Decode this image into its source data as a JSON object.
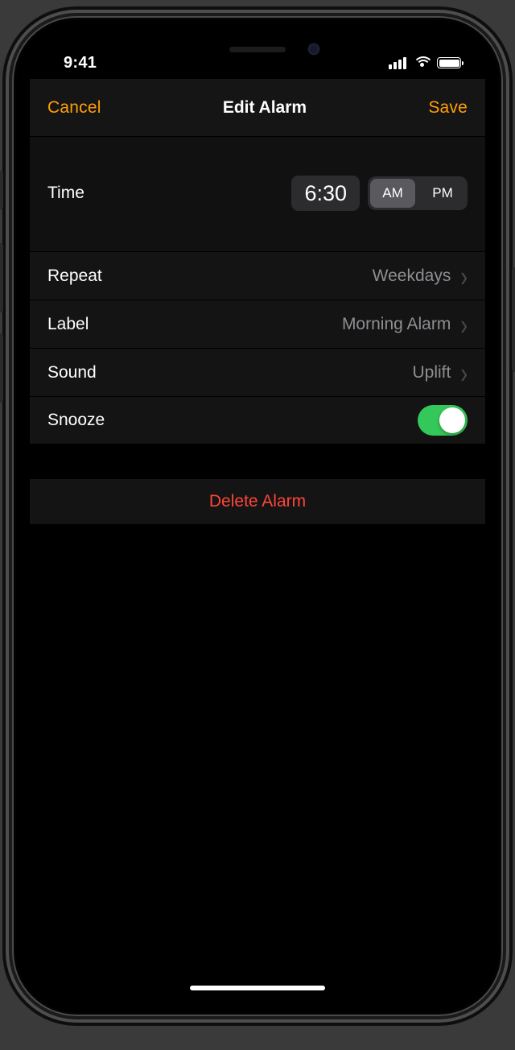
{
  "statusbar": {
    "time": "9:41"
  },
  "nav": {
    "cancel": "Cancel",
    "title": "Edit Alarm",
    "save": "Save"
  },
  "time_row": {
    "label": "Time",
    "value": "6:30",
    "am": "AM",
    "pm": "PM",
    "selected": "AM"
  },
  "settings": {
    "repeat": {
      "label": "Repeat",
      "value": "Weekdays"
    },
    "label": {
      "label": "Label",
      "value": "Morning Alarm"
    },
    "sound": {
      "label": "Sound",
      "value": "Uplift"
    },
    "snooze": {
      "label": "Snooze",
      "on": true
    }
  },
  "delete_label": "Delete Alarm",
  "colors": {
    "accent": "#ff9f0a",
    "destructive": "#ff453a",
    "toggle_on": "#34c759"
  }
}
